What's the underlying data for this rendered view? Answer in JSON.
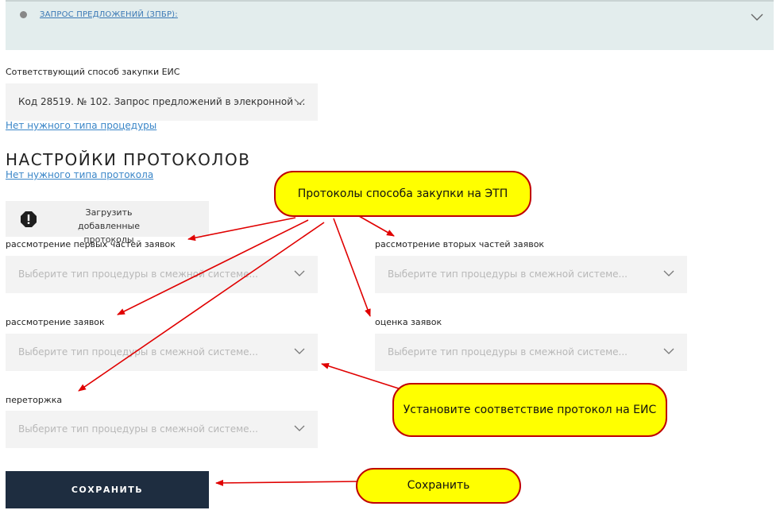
{
  "top_panel": {
    "link_label": "ЗАПРОС ПРЕДЛОЖЕНИЙ (ЗПБР):"
  },
  "eis_method": {
    "label": "Сответствующий способ закупки ЕИС",
    "value": "Код 28519. № 102. Запрос предложений в элекронной ...",
    "missing_link": "Нет нужного типа процедуры"
  },
  "protocols": {
    "heading": "НАСТРОЙКИ ПРОТОКОЛОВ",
    "missing_link": "Нет нужного типа протокола",
    "upload_button": "Загрузить добавленные протоколы",
    "placeholder": "Выберите тип процедуры в смежной системе...",
    "fields": {
      "first_parts": "рассмотрение первых частей заявок",
      "second_parts": "рассмотрение вторых частей заявок",
      "review": "рассмотрение заявок",
      "evaluation": "оценка заявок",
      "rebidding": "переторжка"
    }
  },
  "save_button": "СОХРАНИТЬ",
  "callouts": {
    "etp_protocols": "Протоколы способа закупки на ЭТП",
    "set_match": "Установите соответствие протокол на ЕИС",
    "save": "Сохранить"
  },
  "colors": {
    "callout_fill": "#ffff00",
    "callout_border": "#c00000",
    "save_button": "#1e2d40",
    "arrow": "#e00000"
  }
}
